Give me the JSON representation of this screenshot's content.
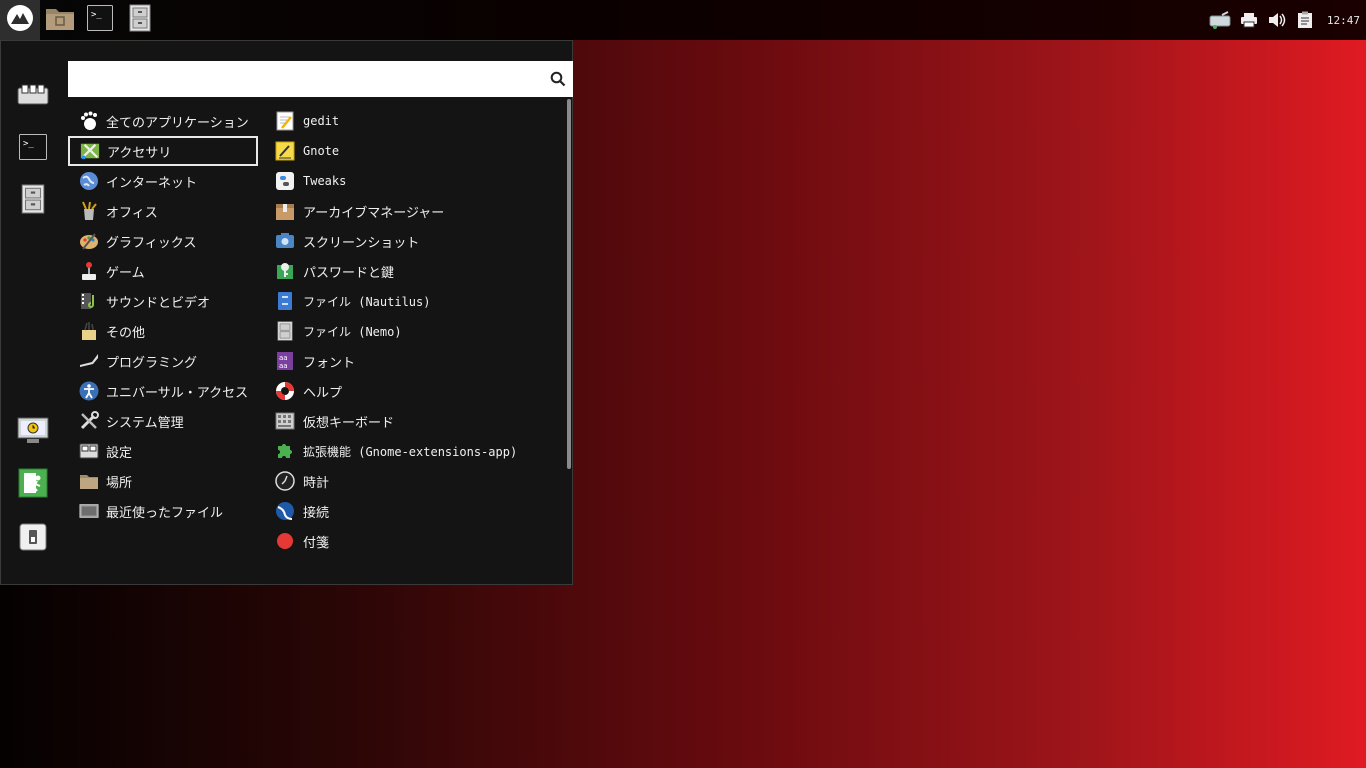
{
  "panel": {
    "launchers": [
      "home-folder-icon",
      "terminal-icon",
      "file-cabinet-icon"
    ],
    "tray": [
      "network-icon",
      "printer-icon",
      "volume-icon",
      "clipboard-icon"
    ],
    "clock": "12:47"
  },
  "menu": {
    "search": {
      "value": "",
      "placeholder": ""
    },
    "rail": [
      "settings-manager-icon",
      "terminal-icon",
      "file-manager-icon",
      "screen-lock-icon",
      "logout-icon",
      "shutdown-icon"
    ],
    "categories": [
      {
        "label": "全てのアプリケーション",
        "icon": "gnome-foot-icon"
      },
      {
        "label": "アクセサリ",
        "icon": "accessories-icon",
        "selected": true
      },
      {
        "label": "インターネット",
        "icon": "globe-icon"
      },
      {
        "label": "オフィス",
        "icon": "office-icon"
      },
      {
        "label": "グラフィックス",
        "icon": "graphics-icon"
      },
      {
        "label": "ゲーム",
        "icon": "joystick-icon"
      },
      {
        "label": "サウンドとビデオ",
        "icon": "multimedia-icon"
      },
      {
        "label": "その他",
        "icon": "other-icon"
      },
      {
        "label": "プログラミング",
        "icon": "programming-icon"
      },
      {
        "label": "ユニバーサル・アクセス",
        "icon": "accessibility-icon"
      },
      {
        "label": "システム管理",
        "icon": "system-tools-icon"
      },
      {
        "label": "設定",
        "icon": "settings-icon"
      },
      {
        "label": "場所",
        "icon": "folder-icon"
      },
      {
        "label": "最近使ったファイル",
        "icon": "recent-files-icon"
      }
    ],
    "apps": [
      {
        "label": "gedit",
        "icon": "text-editor-icon"
      },
      {
        "label": "Gnote",
        "icon": "notes-icon"
      },
      {
        "label": "Tweaks",
        "icon": "tweaks-icon"
      },
      {
        "label": "アーカイブマネージャー",
        "icon": "archive-icon"
      },
      {
        "label": "スクリーンショット",
        "icon": "screenshot-icon"
      },
      {
        "label": "パスワードと鍵",
        "icon": "keyring-icon"
      },
      {
        "label": "ファイル (Nautilus)",
        "icon": "nautilus-icon"
      },
      {
        "label": "ファイル (Nemo)",
        "icon": "nemo-icon"
      },
      {
        "label": "フォント",
        "icon": "fonts-icon"
      },
      {
        "label": "ヘルプ",
        "icon": "help-lifebuoy-icon"
      },
      {
        "label": "仮想キーボード",
        "icon": "keyboard-icon"
      },
      {
        "label": "拡張機能 (Gnome-extensions-app)",
        "icon": "extensions-puzzle-icon"
      },
      {
        "label": "時計",
        "icon": "clock-icon"
      },
      {
        "label": "接続",
        "icon": "connections-icon"
      },
      {
        "label": "付箋",
        "icon": "sticky-icon"
      }
    ]
  },
  "colors": {
    "menu_bg": "#141414",
    "menu_button_bg": "#2e2e2e",
    "text": "#f0f0f0"
  }
}
